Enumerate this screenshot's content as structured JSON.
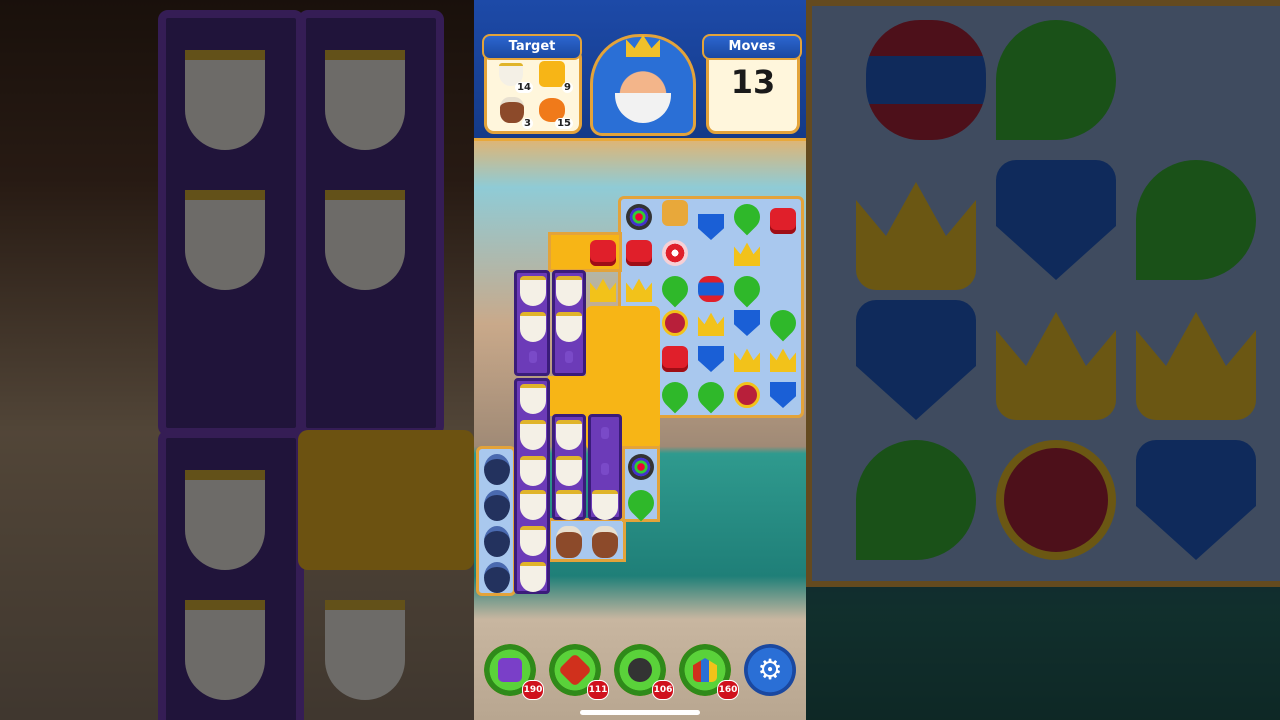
{
  "hud": {
    "target_label": "Target",
    "moves_label": "Moves",
    "moves_value": "13",
    "goals": [
      {
        "icon": "teacup-icon",
        "count": "14"
      },
      {
        "icon": "honey-tile-icon",
        "count": "9"
      },
      {
        "icon": "clay-pot-icon",
        "count": "3"
      },
      {
        "icon": "pumpkin-icon",
        "count": "15"
      }
    ]
  },
  "boosters": [
    {
      "icon": "hammer-box-icon",
      "count": "190"
    },
    {
      "icon": "arrow-icon",
      "count": "111"
    },
    {
      "icon": "cannon-icon",
      "count": "106"
    },
    {
      "icon": "jester-hat-icon",
      "count": "160"
    }
  ],
  "colors": {
    "hud_blue": "#1d4aa8",
    "gold": "#e3a33a",
    "honey": "#f7b516",
    "cup_column": "#6c3bb8"
  }
}
